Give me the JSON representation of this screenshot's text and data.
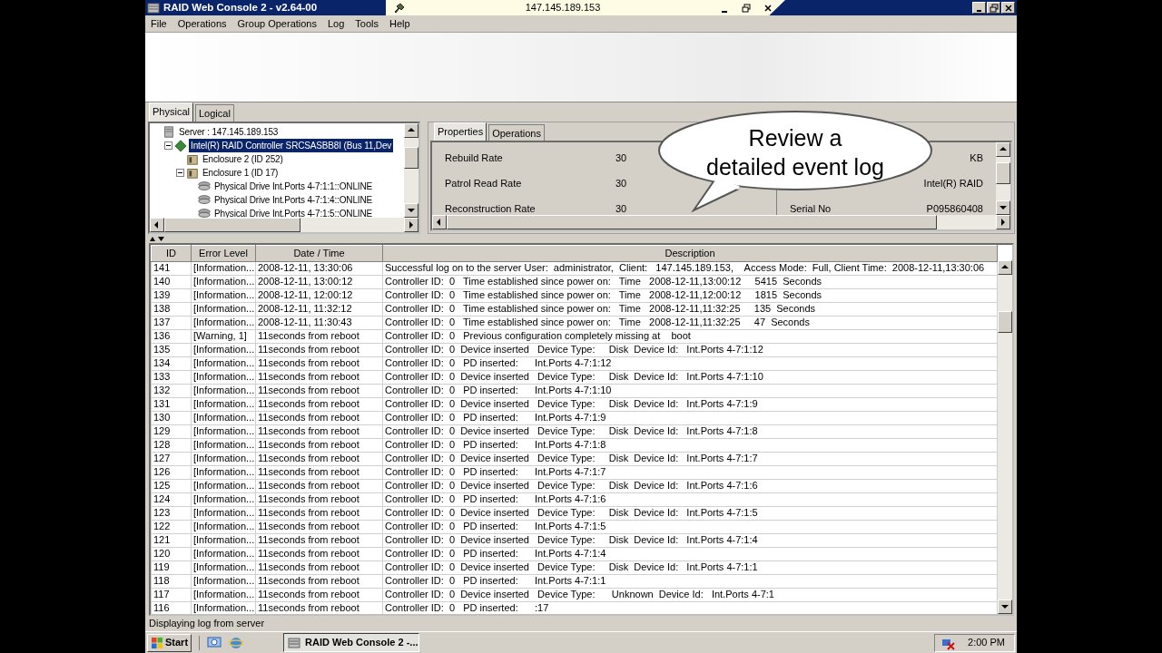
{
  "title_bar": {
    "title": "RAID Web Console 2 - v2.64-00"
  },
  "remote_bar": {
    "address": "147.145.189.153"
  },
  "menu": [
    "File",
    "Operations",
    "Group Operations",
    "Log",
    "Tools",
    "Help"
  ],
  "view_tabs": [
    {
      "label": "Physical",
      "selected": true
    },
    {
      "label": "Logical",
      "selected": false
    }
  ],
  "tree": [
    {
      "label": "Server : 147.145.189.153",
      "kind": "server",
      "selected": false,
      "children": [
        {
          "label": "Intel(R) RAID Controller SRCSASBB8I (Bus 11,Dev",
          "kind": "controller",
          "selected": true,
          "expanded": true,
          "children": [
            {
              "label": "Enclosure  2 (ID 252)",
              "kind": "enclosure",
              "selected": false
            },
            {
              "label": "Enclosure  1 (ID 17)",
              "kind": "enclosure",
              "selected": false,
              "expanded": true,
              "children": [
                {
                  "label": "Physical Drive Int.Ports 4-7:1:1::ONLINE",
                  "kind": "drive",
                  "selected": false
                },
                {
                  "label": "Physical Drive Int.Ports 4-7:1:4::ONLINE",
                  "kind": "drive",
                  "selected": false
                },
                {
                  "label": "Physical Drive Int.Ports 4-7:1:5::ONLINE",
                  "kind": "drive",
                  "selected": false
                }
              ]
            }
          ]
        }
      ]
    }
  ],
  "detail_tabs": [
    {
      "label": "Properties",
      "selected": true
    },
    {
      "label": "Operations",
      "selected": false
    }
  ],
  "properties_left": [
    {
      "label": "Rebuild Rate",
      "value": "30"
    },
    {
      "label": "Patrol Read Rate",
      "value": "30"
    },
    {
      "label": "Reconstruction Rate",
      "value": "30"
    }
  ],
  "properties_right": [
    {
      "value": "KB"
    },
    {
      "value": "Intel(R) RAID"
    },
    {
      "label": "Serial No",
      "value": "P095860408"
    }
  ],
  "callout": {
    "lines": [
      "Review a",
      "detailed event log"
    ]
  },
  "log": {
    "columns": [
      "ID",
      "Error Level",
      "Date / Time",
      "Description"
    ],
    "rows": [
      {
        "id": "141",
        "level": "[Information...",
        "time": "2008-12-11, 13:30:06",
        "description": "Successful log on to the server User:  administrator,  Client:   147.145.189.153,    Access Mode:  Full, Client Time:  2008-12-11,13:30:06"
      },
      {
        "id": "140",
        "level": "[Information...",
        "time": "2008-12-11, 13:00:12",
        "description": "Controller ID:  0   Time established since power on:   Time   2008-12-11,13:00:12     5415  Seconds"
      },
      {
        "id": "139",
        "level": "[Information...",
        "time": "2008-12-11, 12:00:12",
        "description": "Controller ID:  0   Time established since power on:   Time   2008-12-11,12:00:12     1815  Seconds"
      },
      {
        "id": "138",
        "level": "[Information...",
        "time": "2008-12-11, 11:32:12",
        "description": "Controller ID:  0   Time established since power on:   Time   2008-12-11,11:32:25     135  Seconds"
      },
      {
        "id": "137",
        "level": "[Information...",
        "time": "2008-12-11, 11:30:43",
        "description": "Controller ID:  0   Time established since power on:   Time   2008-12-11,11:32:25     47  Seconds"
      },
      {
        "id": "136",
        "level": "[Warning, 1]",
        "time": "11seconds from reboot",
        "description": "Controller ID:  0   Previous configuration completely missing at    boot"
      },
      {
        "id": "135",
        "level": "[Information...",
        "time": "11seconds from reboot",
        "description": "Controller ID:  0  Device inserted   Device Type:     Disk  Device Id:   Int.Ports 4-7:1:12"
      },
      {
        "id": "134",
        "level": "[Information...",
        "time": "11seconds from reboot",
        "description": "Controller ID:  0   PD inserted:      Int.Ports 4-7:1:12"
      },
      {
        "id": "133",
        "level": "[Information...",
        "time": "11seconds from reboot",
        "description": "Controller ID:  0  Device inserted   Device Type:     Disk  Device Id:   Int.Ports 4-7:1:10"
      },
      {
        "id": "132",
        "level": "[Information...",
        "time": "11seconds from reboot",
        "description": "Controller ID:  0   PD inserted:      Int.Ports 4-7:1:10"
      },
      {
        "id": "131",
        "level": "[Information...",
        "time": "11seconds from reboot",
        "description": "Controller ID:  0  Device inserted   Device Type:     Disk  Device Id:   Int.Ports 4-7:1:9"
      },
      {
        "id": "130",
        "level": "[Information...",
        "time": "11seconds from reboot",
        "description": "Controller ID:  0   PD inserted:      Int.Ports 4-7:1:9"
      },
      {
        "id": "129",
        "level": "[Information...",
        "time": "11seconds from reboot",
        "description": "Controller ID:  0  Device inserted   Device Type:     Disk  Device Id:   Int.Ports 4-7:1:8"
      },
      {
        "id": "128",
        "level": "[Information...",
        "time": "11seconds from reboot",
        "description": "Controller ID:  0   PD inserted:      Int.Ports 4-7:1:8"
      },
      {
        "id": "127",
        "level": "[Information...",
        "time": "11seconds from reboot",
        "description": "Controller ID:  0  Device inserted   Device Type:     Disk  Device Id:   Int.Ports 4-7:1:7"
      },
      {
        "id": "126",
        "level": "[Information...",
        "time": "11seconds from reboot",
        "description": "Controller ID:  0   PD inserted:      Int.Ports 4-7:1:7"
      },
      {
        "id": "125",
        "level": "[Information...",
        "time": "11seconds from reboot",
        "description": "Controller ID:  0  Device inserted   Device Type:     Disk  Device Id:   Int.Ports 4-7:1:6"
      },
      {
        "id": "124",
        "level": "[Information...",
        "time": "11seconds from reboot",
        "description": "Controller ID:  0   PD inserted:      Int.Ports 4-7:1:6"
      },
      {
        "id": "123",
        "level": "[Information...",
        "time": "11seconds from reboot",
        "description": "Controller ID:  0  Device inserted   Device Type:     Disk  Device Id:   Int.Ports 4-7:1:5"
      },
      {
        "id": "122",
        "level": "[Information...",
        "time": "11seconds from reboot",
        "description": "Controller ID:  0   PD inserted:      Int.Ports 4-7:1:5"
      },
      {
        "id": "121",
        "level": "[Information...",
        "time": "11seconds from reboot",
        "description": "Controller ID:  0  Device inserted   Device Type:     Disk  Device Id:   Int.Ports 4-7:1:4"
      },
      {
        "id": "120",
        "level": "[Information...",
        "time": "11seconds from reboot",
        "description": "Controller ID:  0   PD inserted:      Int.Ports 4-7:1:4"
      },
      {
        "id": "119",
        "level": "[Information...",
        "time": "11seconds from reboot",
        "description": "Controller ID:  0  Device inserted   Device Type:     Disk  Device Id:   Int.Ports 4-7:1:1"
      },
      {
        "id": "118",
        "level": "[Information...",
        "time": "11seconds from reboot",
        "description": "Controller ID:  0   PD inserted:      Int.Ports 4-7:1:1"
      },
      {
        "id": "117",
        "level": "[Information...",
        "time": "11seconds from reboot",
        "description": "Controller ID:  0  Device inserted   Device Type:      Unknown  Device Id:   Int.Ports 4-7:1"
      },
      {
        "id": "116",
        "level": "[Information...",
        "time": "11seconds from reboot",
        "description": "Controller ID:  0   PD inserted:      :17"
      }
    ]
  },
  "status_bar": "Displaying log from server",
  "taskbar": {
    "start": "Start",
    "task": "RAID Web Console 2 -...",
    "clock": "2:00 PM"
  }
}
